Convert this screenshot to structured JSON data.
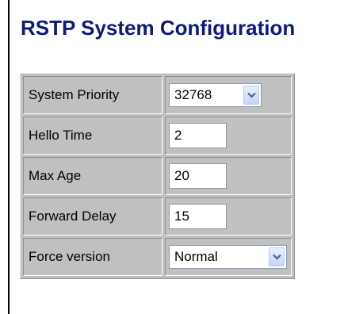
{
  "page": {
    "title": "RSTP System Configuration"
  },
  "form": {
    "system_priority": {
      "label": "System Priority",
      "value": "32768"
    },
    "hello_time": {
      "label": "Hello Time",
      "value": "2"
    },
    "max_age": {
      "label": "Max Age",
      "value": "20"
    },
    "forward_delay": {
      "label": "Forward Delay",
      "value": "15"
    },
    "force_version": {
      "label": "Force version",
      "value": "Normal"
    }
  },
  "icons": {
    "dropdown": "chevron-down-icon"
  },
  "colors": {
    "title": "#0f1a78",
    "table_bg": "#c0c0c0",
    "arrow": "#4d6185"
  }
}
